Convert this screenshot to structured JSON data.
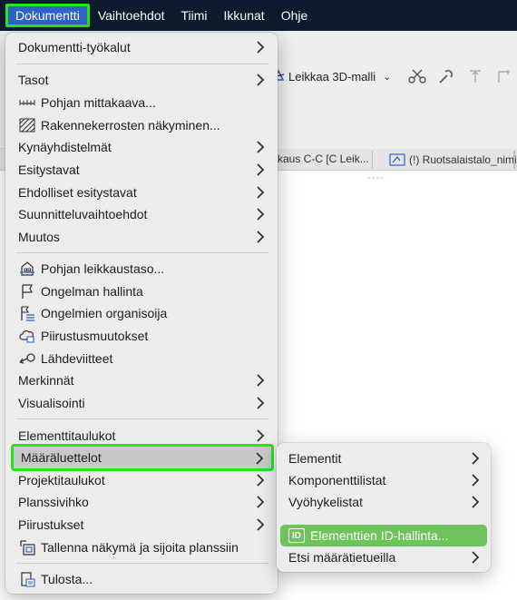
{
  "menubar": {
    "items": [
      "Dokumentti",
      "Vaihtoehdot",
      "Tiimi",
      "Ikkunat",
      "Ohje"
    ]
  },
  "background": {
    "cut3d_label": "Leikkaa 3D-malli",
    "tab1_label": "kaus C-C [C Leik...",
    "tab2_label": "(!) Ruotsalaistalo_nimiö"
  },
  "menu": {
    "items": [
      {
        "label": "Dokumentti-työkalut",
        "submenu": true
      },
      {
        "label": "Tasot",
        "submenu": true
      },
      {
        "label": "Pohjan mittakaava...",
        "submenu": false,
        "icon": "scale-icon"
      },
      {
        "label": "Rakennekerrosten näkyminen...",
        "submenu": false,
        "icon": "hatch-icon"
      },
      {
        "label": "Kynäyhdistelmät",
        "submenu": true
      },
      {
        "label": "Esitystavat",
        "submenu": true
      },
      {
        "label": "Ehdolliset esitystavat",
        "submenu": true
      },
      {
        "label": "Suunnitteluvaihtoehdot",
        "submenu": true
      },
      {
        "label": "Muutos",
        "submenu": true
      },
      {
        "label": "Pohjan leikkaustaso...",
        "submenu": false,
        "icon": "building-cut-icon"
      },
      {
        "label": "Ongelman hallinta",
        "submenu": false,
        "icon": "flag-icon"
      },
      {
        "label": "Ongelmien organisoija",
        "submenu": false,
        "icon": "flag-list-icon"
      },
      {
        "label": "Piirustusmuutokset",
        "submenu": false,
        "icon": "revision-cloud-icon"
      },
      {
        "label": "Lähdeviitteet",
        "submenu": false,
        "icon": "reference-icon"
      },
      {
        "label": "Merkinnät",
        "submenu": true
      },
      {
        "label": "Visualisointi",
        "submenu": true
      },
      {
        "label": "Elementtitaulukot",
        "submenu": true
      },
      {
        "label": "Määräluettelot",
        "submenu": true
      },
      {
        "label": "Projektitaulukot",
        "submenu": true
      },
      {
        "label": "Planssivihko",
        "submenu": true
      },
      {
        "label": "Piirustukset",
        "submenu": true
      },
      {
        "label": "Tallenna näkymä ja sijoita planssiin",
        "submenu": false,
        "icon": "save-place-icon"
      },
      {
        "label": "Tulosta...",
        "submenu": false,
        "icon": "print-icon"
      }
    ]
  },
  "submenu": {
    "items": [
      {
        "label": "Elementit",
        "submenu": true
      },
      {
        "label": "Komponenttilistat",
        "submenu": true
      },
      {
        "label": "Vyöhykelistat",
        "submenu": true
      },
      {
        "label": "Elementtien ID-hallinta...",
        "submenu": false,
        "icon_text": "ID"
      },
      {
        "label": "Etsi määrätietueilla",
        "submenu": true
      }
    ]
  },
  "colors": {
    "menubar_bg": "#0e1b2e",
    "highlight_outline": "#22e51a",
    "selected_submenu_item": "#6ec35a",
    "active_menu_bg": "#2d62c9"
  }
}
